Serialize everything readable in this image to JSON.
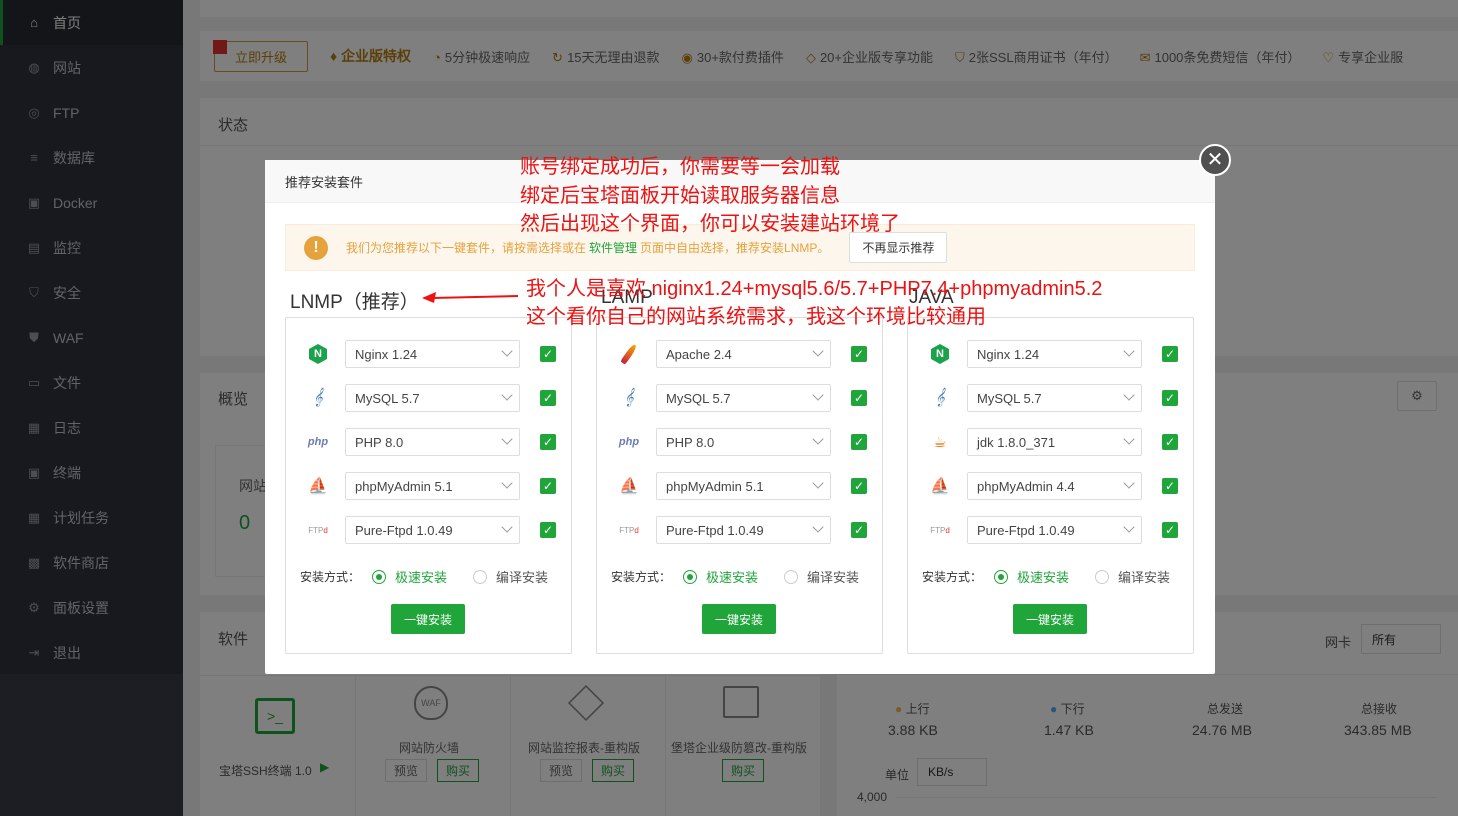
{
  "sidebar": {
    "items": [
      {
        "label": "首页",
        "icon": "home-icon",
        "glyph": "⌂"
      },
      {
        "label": "网站",
        "icon": "globe-icon",
        "glyph": "◍"
      },
      {
        "label": "FTP",
        "icon": "ftp-icon",
        "glyph": "◎"
      },
      {
        "label": "数据库",
        "icon": "database-icon",
        "glyph": "≡"
      },
      {
        "label": "Docker",
        "icon": "docker-icon",
        "glyph": "▣"
      },
      {
        "label": "监控",
        "icon": "monitor-icon",
        "glyph": "▤"
      },
      {
        "label": "安全",
        "icon": "shield-icon",
        "glyph": "⛉"
      },
      {
        "label": "WAF",
        "icon": "waf-icon",
        "glyph": "⛊"
      },
      {
        "label": "文件",
        "icon": "folder-icon",
        "glyph": "▭"
      },
      {
        "label": "日志",
        "icon": "log-icon",
        "glyph": "▦"
      },
      {
        "label": "终端",
        "icon": "terminal-icon",
        "glyph": "▣"
      },
      {
        "label": "计划任务",
        "icon": "calendar-icon",
        "glyph": "▦"
      },
      {
        "label": "软件商店",
        "icon": "store-icon",
        "glyph": "▩"
      },
      {
        "label": "面板设置",
        "icon": "gear-icon",
        "glyph": "⚙"
      },
      {
        "label": "退出",
        "icon": "logout-icon",
        "glyph": "⇥"
      }
    ]
  },
  "promo": {
    "upgrade": "立即升级",
    "title": "企业版特权",
    "items": [
      "5分钟极速响应",
      "15天无理由退款",
      "30+款付费插件",
      "20+企业版专享功能",
      "2张SSL商用证书（年付）",
      "1000条免费短信（年付）",
      "专享企业服"
    ]
  },
  "sections": {
    "status": "状态",
    "overview": "概览",
    "software": "软件",
    "site_short": "网站",
    "site_count": "0"
  },
  "software_items": [
    {
      "name": "宝塔SSH终端 1.0"
    },
    {
      "name": "网站防火墙",
      "preview": "预览",
      "buy": "购买"
    },
    {
      "name": "网站监控报表-重构版",
      "preview": "预览",
      "buy": "购买"
    },
    {
      "name": "堡塔企业级防篡改-重构版",
      "buy": "购买"
    }
  ],
  "network": {
    "nic_label": "网卡",
    "nic_value": "所有",
    "up_label": "上行",
    "up_value": "3.88 KB",
    "down_label": "下行",
    "down_value": "1.47 KB",
    "sent_label": "总发送",
    "sent_value": "24.76 MB",
    "recv_label": "总接收",
    "recv_value": "343.85 MB",
    "unit_label": "单位",
    "unit_value": "KB/s",
    "axis_max": "4,000"
  },
  "modal": {
    "title": "推荐安装套件",
    "notice_pre": "我们为您推荐以下一键套件，请按需选择或在",
    "notice_link": "软件管理",
    "notice_post": "页面中自由选择，推荐安装LNMP。",
    "no_show": "不再显示推荐",
    "install_mode_label": "安装方式：",
    "fast": "极速安装",
    "compile": "编译安装",
    "install_btn": "一键安装",
    "columns": [
      {
        "title": "LNMP（推荐）",
        "rows": [
          {
            "icon": "nginx-icon",
            "value": "Nginx 1.24"
          },
          {
            "icon": "mysql-icon",
            "value": "MySQL 5.7"
          },
          {
            "icon": "php-icon",
            "value": "PHP 8.0"
          },
          {
            "icon": "phpmyadmin-icon",
            "value": "phpMyAdmin 5.1"
          },
          {
            "icon": "ftp-icon",
            "value": "Pure-Ftpd 1.0.49"
          }
        ]
      },
      {
        "title": "LAMP",
        "rows": [
          {
            "icon": "apache-icon",
            "value": "Apache 2.4"
          },
          {
            "icon": "mysql-icon",
            "value": "MySQL 5.7"
          },
          {
            "icon": "php-icon",
            "value": "PHP 8.0"
          },
          {
            "icon": "phpmyadmin-icon",
            "value": "phpMyAdmin 5.1"
          },
          {
            "icon": "ftp-icon",
            "value": "Pure-Ftpd 1.0.49"
          }
        ]
      },
      {
        "title": "JAVA",
        "rows": [
          {
            "icon": "nginx-icon",
            "value": "Nginx 1.24"
          },
          {
            "icon": "mysql-icon",
            "value": "MySQL 5.7"
          },
          {
            "icon": "java-icon",
            "value": "jdk 1.8.0_371"
          },
          {
            "icon": "phpmyadmin-icon",
            "value": "phpMyAdmin 4.4"
          },
          {
            "icon": "ftp-icon",
            "value": "Pure-Ftpd 1.0.49"
          }
        ]
      }
    ]
  },
  "annotations": {
    "line1": "账号绑定成功后，你需要等一会加载",
    "line2": "绑定后宝塔面板开始读取服务器信息",
    "line3": "然后出现这个界面，你可以安装建站环境了",
    "line4": "我个人是喜欢   niginx1.24+mysql5.6/5.7+PHP7.4+phpmyadmin5.2",
    "line5": "这个看你自己的网站系统需求，我这个环境比较通用"
  },
  "colors": {
    "accent": "#20a53a",
    "sidebar": "#2f333e",
    "annotation": "#ee1111",
    "warning": "#e6a23c"
  }
}
